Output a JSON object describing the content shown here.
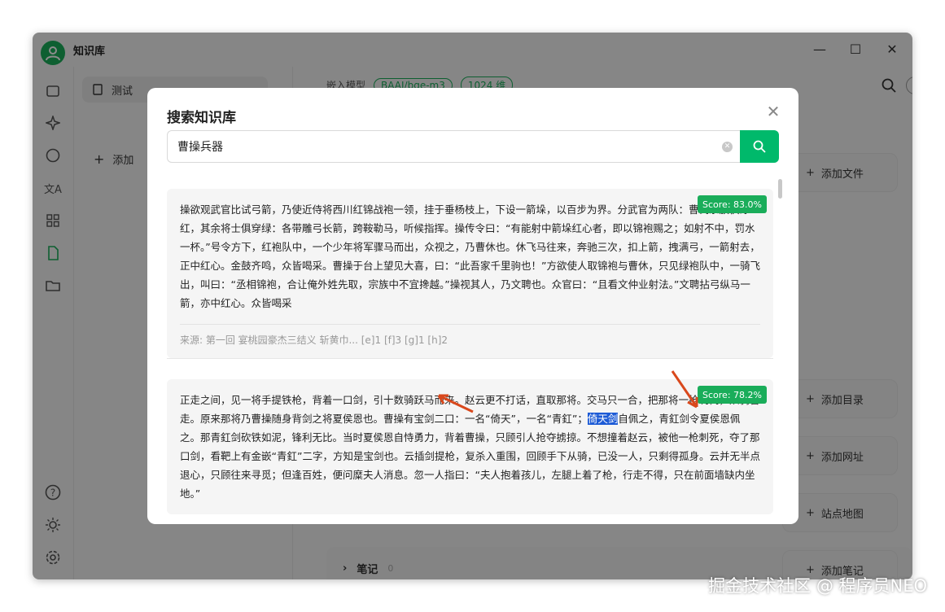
{
  "app": {
    "title": "知识库"
  },
  "left_panel": {
    "kb_item": "测试",
    "add_label": "添加"
  },
  "main": {
    "embed_label": "嵌入模型",
    "model_tag": "BAAI/bge-m3",
    "dim_tag": "1024 维",
    "buttons": {
      "add_file": "添加文件",
      "add_dir": "添加目录",
      "add_url": "添加网址",
      "sitemap": "站点地图",
      "add_note": "添加笔记"
    },
    "notes_label": "笔记",
    "notes_count": "0"
  },
  "modal": {
    "title": "搜索知识库",
    "query": "曹操兵器",
    "results": [
      {
        "score": "Score: 83.0%",
        "text": "操欲观武官比试弓箭，乃使近侍将西川红锦战袍一领，挂于垂杨枝上，下设一箭垛，以百步为界。分武官为两队：曹氏宗族俱穿红，其余将士俱穿绿：各带雕弓长箭，跨鞍勒马，听候指挥。操传令曰：“有能射中箭垛红心者，即以锦袍赐之；如射不中，罚水一杯。”号令方下，红袍队中，一个少年将军骤马而出，众视之，乃曹休也。休飞马往来，奔驰三次，扣上箭，拽满弓，一箭射去，正中红心。金鼓齐鸣，众皆喝采。曹操于台上望见大喜，曰：“此吾家千里驹也！”方欲使人取锦袍与曹休，只见绿袍队中，一骑飞出，叫曰：“丞相锦袍，合让俺外姓先取，宗族中不宜搀越。”操视其人，乃文聘也。众官曰：“且看文仲业射法。”文聘拈弓纵马一箭，亦中红心。众皆喝采",
        "source": "来源: 第一回 宴桃园豪杰三结义 斩黄巾... [e]1 [f]3 [g]1 [h]2"
      },
      {
        "score": "Score: 78.2%",
        "text_before": "正走之间，见一将手提铁枪，背着一口剑，引十数骑跃马而来。赵云更不打话，直取那将。交马只一合，把那将一枪刺倒，从骑皆走。原来那将乃曹操随身背剑之将夏侯恩也。曹操有宝剑二口：一名“倚天”，一名“青釭”；",
        "highlight": "倚天剑",
        "text_after": "自佩之，青釭剑令夏侯恩佩之。那青釭剑砍铁如泥，锋利无比。当时夏侯恩自恃勇力，背着曹操，只顾引人抢夺掳掠。不想撞着赵云，被他一枪刺死，夺了那口剑，看靶上有金嵌“青釭”二字，方知是宝剑也。云插剑提枪，复杀入重围，回顾手下从骑，已没一人，只剩得孤身。云并无半点退心，只顾往来寻觅；但逢百姓，便问糜夫人消息。忽一人指曰：“夫人抱着孩儿，左腿上着了枪，行走不得，只在前面墙缺内坐地。”"
      }
    ]
  },
  "watermark": "掘金技术社区 @ 程序员NEO",
  "colors": {
    "accent": "#00b96b",
    "highlight": "#1d5bd6",
    "arrow": "#d9481c"
  }
}
